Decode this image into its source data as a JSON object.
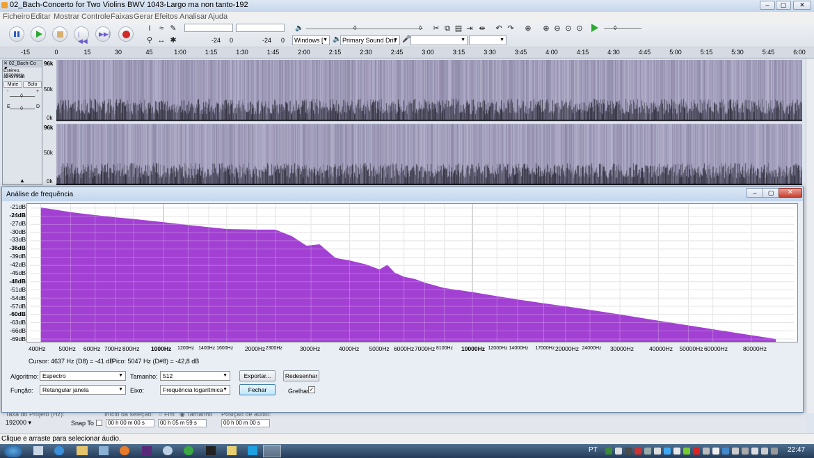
{
  "window": {
    "title": "02_Bach-Concerto for Two Violins BWV 1043-Largo ma non tanto-192"
  },
  "menu": [
    "Ficheiro",
    "Editar",
    "Mostrar",
    "Controle",
    "Faixas",
    "Gerar",
    "Efeitos",
    "Analisar",
    "Ajuda"
  ],
  "toolbar": {
    "meter_left_val": "-24",
    "meter_left_zero": "0",
    "meter_right_val": "-24",
    "meter_right_zero": "0",
    "host": "Windows [",
    "output_device": "Primary Sound Driv"
  },
  "ruler": {
    "ticks": [
      "-15",
      "0",
      "15",
      "30",
      "45",
      "1:00",
      "1:15",
      "1:30",
      "1:45",
      "2:00",
      "2:15",
      "2:30",
      "2:45",
      "3:00",
      "3:15",
      "3:30",
      "3:45",
      "4:00",
      "4:15",
      "4:30",
      "4:45",
      "5:00",
      "5:15",
      "5:30",
      "5:45",
      "6:00"
    ]
  },
  "track": {
    "name": "02_Bach-Co",
    "info1": "Estéreo, 192000Hz",
    "info2": "32-bit float",
    "mute": "Mute",
    "solo": "Solo",
    "gain_minus": "-",
    "gain_plus": "+",
    "pan_l": "E",
    "pan_r": "D",
    "axis_top": [
      "96k",
      "50k",
      "0k"
    ],
    "axis_bottom": [
      "96k",
      "50k",
      "0k"
    ]
  },
  "dialog": {
    "title": "Análise de frequência",
    "close": "✕",
    "yticks": [
      "-21dB",
      "-24dB",
      "-27dB",
      "-30dB",
      "-33dB",
      "-36dB",
      "-39dB",
      "-42dB",
      "-45dB",
      "-48dB",
      "-51dB",
      "-54dB",
      "-57dB",
      "-60dB",
      "-63dB",
      "-66dB",
      "-69dB"
    ],
    "xticks": [
      "400Hz",
      "500Hz",
      "600Hz",
      "700Hz",
      "800Hz",
      "1000Hz",
      "1200Hz",
      "1400Hz",
      "1600Hz",
      "2000Hz",
      "2300Hz",
      "3000Hz",
      "4000Hz",
      "5000Hz",
      "6000Hz",
      "7000Hz",
      "8100Hz",
      "10000Hz",
      "12000Hz",
      "14000Hz",
      "17000Hz",
      "20000Hz",
      "24000Hz",
      "30000Hz",
      "40000Hz",
      "50000Hz",
      "60000Hz",
      "80000Hz"
    ],
    "cursor": "Cursor: 4637 Hz (D8) = -41 dB",
    "peak": "Pico: 5047 Hz (D#8) = -42,8 dB",
    "algorithm_label": "Algoritmo:",
    "algorithm_value": "Espectro",
    "size_label": "Tamanho:",
    "size_value": "512",
    "export_btn": "Exportar...",
    "redraw_btn": "Redesenhar",
    "function_label": "Função:",
    "function_value": "Retangular janela",
    "axis_label": "Eixo:",
    "axis_value": "Frequência logarítmica",
    "close_btn": "Fechar",
    "grid_label": "Grelhas",
    "grid_checked": "✓",
    "fill_color": "#9b30d0"
  },
  "chart_data": {
    "type": "area",
    "x": [
      400,
      500,
      600,
      700,
      800,
      1000,
      1200,
      1400,
      1600,
      2000,
      2300,
      2600,
      2900,
      3200,
      3600,
      4000,
      4500,
      5000,
      5300,
      5600,
      6000,
      6500,
      7000,
      8100,
      10000,
      12000,
      14000,
      17000,
      20000,
      24000,
      30000,
      40000,
      50000,
      60000,
      80000,
      96000
    ],
    "values": [
      -20.8,
      -22.5,
      -23.6,
      -24.4,
      -25.0,
      -26.2,
      -27.2,
      -28.0,
      -28.7,
      -28.9,
      -28.9,
      -31.3,
      -34.8,
      -34.3,
      -39.3,
      -40.2,
      -41.6,
      -43.5,
      -41.8,
      -44.7,
      -46.2,
      -47.0,
      -48.3,
      -50.3,
      -51.8,
      -53.3,
      -54.5,
      -55.9,
      -57.0,
      -58.3,
      -60.0,
      -62.3,
      -64.0,
      -65.4,
      -67.6,
      -69.0
    ],
    "xlabel": "",
    "ylabel": "",
    "ylim": [
      -70,
      -19.5
    ],
    "xlim": [
      370,
      110000
    ],
    "xscale": "log",
    "grid": true
  },
  "bottom": {
    "rate_label": "Taxa do Projeto (Hz):",
    "rate_value": "192000",
    "snap_label": "Snap To",
    "sel_start_label": "Início da seleção:",
    "end_label": "Fim",
    "length_label": "Tamanho",
    "start_time": "00 h 00 m 00 s",
    "length_time": "00 h 05 m 59 s",
    "pos_label": "Posição de áudio:",
    "pos_time": "00 h 00 m 00 s"
  },
  "status": {
    "text": "Clique e arraste para selecionar áudio."
  },
  "taskbar": {
    "lang": "PT",
    "clock": "22:47"
  }
}
